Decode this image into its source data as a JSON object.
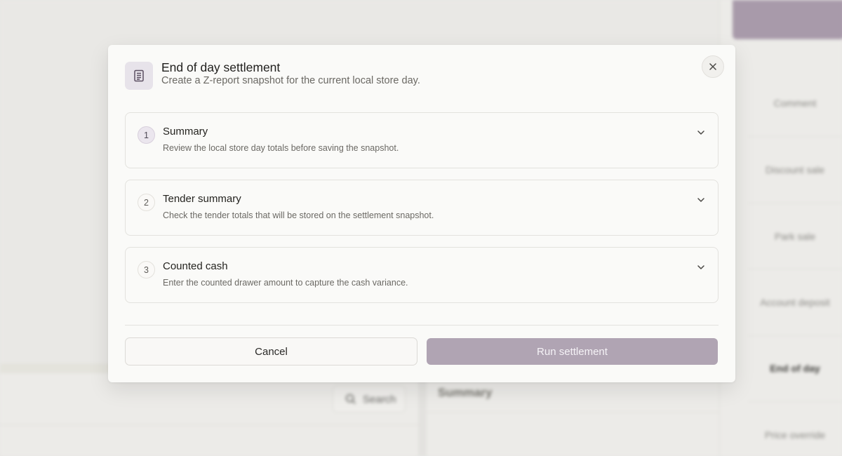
{
  "background": {
    "search_label": "Search",
    "summary_label": "Summary",
    "actions": [
      "Comment",
      "Discount sale",
      "Park sale",
      "Account deposit",
      "End of day",
      "Price override"
    ],
    "active_action": "End of day"
  },
  "modal": {
    "icon": "receipt-icon",
    "title": "End of day settlement",
    "subtitle": "Create a Z-report snapshot for the current local store day.",
    "close_icon": "close-icon",
    "steps": [
      {
        "number": "1",
        "title": "Summary",
        "description": "Review the local store day totals before saving the snapshot."
      },
      {
        "number": "2",
        "title": "Tender summary",
        "description": "Check the tender totals that will be stored on the settlement snapshot."
      },
      {
        "number": "3",
        "title": "Counted cash",
        "description": "Enter the counted drawer amount to capture the cash variance."
      }
    ],
    "cancel_label": "Cancel",
    "run_label": "Run settlement"
  },
  "colors": {
    "accent": "#b0a4b3",
    "accent_background_bar": "#a89aaa",
    "modal_background": "#fafaf8"
  }
}
